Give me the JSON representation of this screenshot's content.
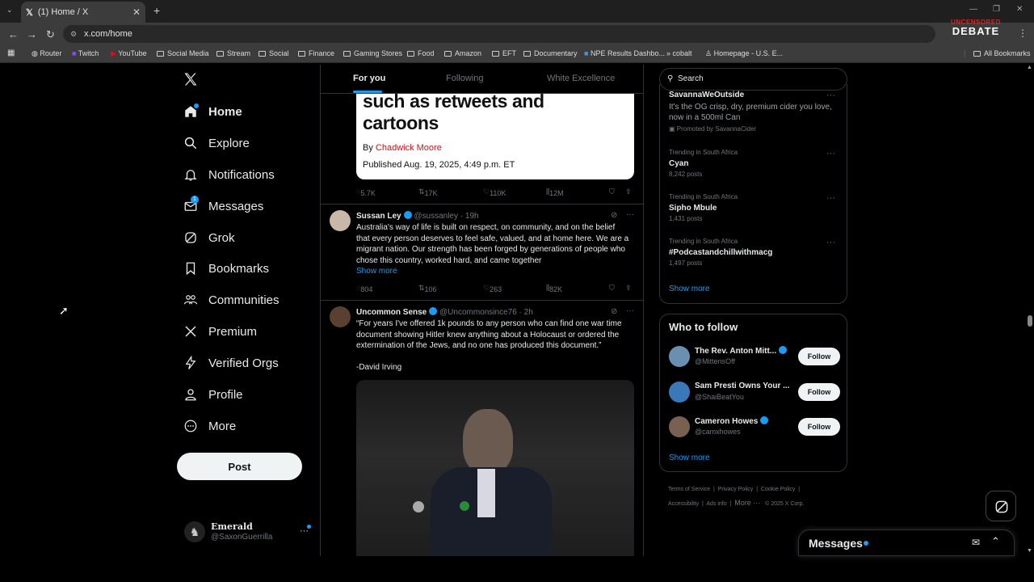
{
  "browser": {
    "tab_title": "(1) Home / X",
    "url": "x.com/home",
    "bookmarks": [
      "Router",
      "Twitch",
      "YouTube",
      "Social Media",
      "Stream",
      "Social",
      "Finance",
      "Gaming Stores",
      "Food",
      "Amazon",
      "EFT",
      "Documentary",
      "NPE Results Dashbo...",
      "cobalt",
      "Homepage - U.S. E..."
    ],
    "all_bookmarks": "All Bookmarks",
    "corner_logo_line1": "UNCENSORED",
    "corner_logo_line2": "DEBATE"
  },
  "nav": {
    "items": [
      {
        "label": "Home",
        "icon": "home-icon"
      },
      {
        "label": "Explore",
        "icon": "search-icon"
      },
      {
        "label": "Notifications",
        "icon": "bell-icon"
      },
      {
        "label": "Messages",
        "icon": "mail-icon",
        "badge": "1"
      },
      {
        "label": "Grok",
        "icon": "grok-icon"
      },
      {
        "label": "Bookmarks",
        "icon": "bookmark-icon"
      },
      {
        "label": "Communities",
        "icon": "communities-icon"
      },
      {
        "label": "Premium",
        "icon": "x-icon"
      },
      {
        "label": "Verified Orgs",
        "icon": "lightning-icon"
      },
      {
        "label": "Profile",
        "icon": "person-icon"
      },
      {
        "label": "More",
        "icon": "more-circle-icon"
      }
    ],
    "post_label": "Post",
    "account_name": "Emerald",
    "account_handle": "@SaxonGuerrilla"
  },
  "feed": {
    "tabs": [
      "For you",
      "Following",
      "White Excellence"
    ],
    "article": {
      "headline_line1": "such as retweets and",
      "headline_line2": "cartoons",
      "byline_prefix": "By ",
      "byline_author": "Chadwick Moore",
      "published": "Published Aug. 19, 2025, 4:49 p.m. ET"
    },
    "article_stats": {
      "replies": "5.7K",
      "reposts": "17K",
      "likes": "110K",
      "views": "12M"
    },
    "tweets": [
      {
        "name": "Sussan Ley",
        "handle": "@sussanley · 19h",
        "lines": [
          "Australia's way of life is built on respect, on community, and on the belief",
          "that every person deserves to feel safe, valued, and at home here. We are a",
          "migrant nation. Our strength has been forged by generations of people who",
          "chose this country, worked hard, and came together"
        ],
        "show_more": "Show more",
        "stats": {
          "replies": "804",
          "reposts": "106",
          "likes": "263",
          "views": "82K"
        }
      },
      {
        "name": "Uncommon Sense",
        "handle": "@Uncommonsince76 · 2h",
        "lines": [
          "“For years I've offered 1k pounds to any person who can find one war time",
          "document showing Hitler knew anything about a Holocaust or ordered the",
          "extermination of the Jews, and no one has produced this document.”"
        ],
        "signature": "-David Irving"
      }
    ]
  },
  "right": {
    "search_placeholder": "Search",
    "promo": {
      "name": "SavannaWeOutside",
      "line1": "It's the OG crisp, dry, premium cider you love,",
      "line2": "now in a 500ml Can",
      "promoted": "Promoted by SavannaCider"
    },
    "trends": [
      {
        "context": "Trending in South Africa",
        "name": "Cyan",
        "count": "8,242 posts"
      },
      {
        "context": "Trending in South Africa",
        "name": "Sipho Mbule",
        "count": "1,431 posts"
      },
      {
        "context": "Trending in South Africa",
        "name": "#Podcastandchillwithmacg",
        "count": "1,497 posts"
      }
    ],
    "trends_show_more": "Show more",
    "who_to_follow_title": "Who to follow",
    "who_to_follow": [
      {
        "name": "The Rev. Anton Mitt...",
        "handle": "@MittensOff",
        "button": "Follow",
        "verified": true
      },
      {
        "name": "Sam Presti Owns Your ...",
        "handle": "@ShaiBeatYou",
        "button": "Follow",
        "verified": false
      },
      {
        "name": "Cameron Howes",
        "handle": "@camxhowes",
        "button": "Follow",
        "verified": true
      }
    ],
    "wtf_show_more": "Show more",
    "footer_row1": [
      "Terms of Service",
      "Privacy Policy",
      "Cookie Policy"
    ],
    "footer_row2": [
      "Accessibility",
      "Ads info",
      "More ···",
      "© 2025 X Corp."
    ],
    "messages_dock": "Messages"
  },
  "colors": {
    "accent": "#1d9bf0",
    "background": "#000000",
    "byline_red": "#c4161c"
  }
}
